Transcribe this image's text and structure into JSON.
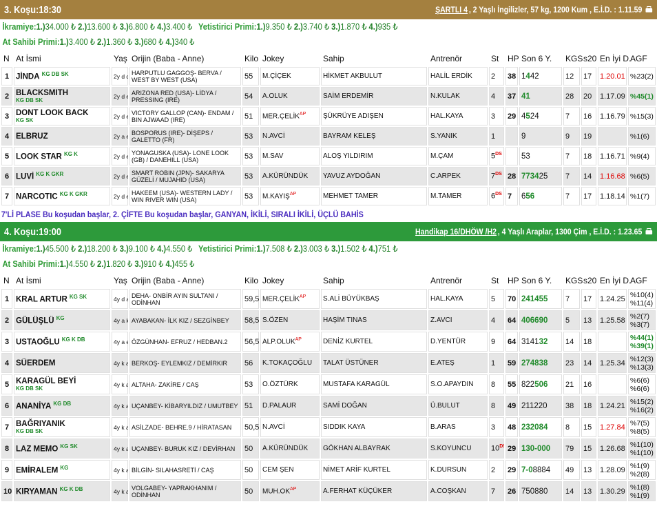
{
  "race3": {
    "title": "3. Koşu:18:30",
    "cond": "ŞARTLI 4",
    "info": " , 2 Yaşlı İngilizler, 57 kg, 1200 Kum , E.İ.D. : 1.11.59",
    "prize_line1": [
      {
        "label": "İkramiye:",
        "items": [
          {
            "k": "1.)",
            "v": "34.000 ₺"
          },
          {
            "k": "2.)",
            "v": "13.600 ₺"
          },
          {
            "k": "3.)",
            "v": "6.800 ₺"
          },
          {
            "k": "4.)",
            "v": "3.400 ₺"
          }
        ]
      },
      {
        "label": "Yetistirici Primi:",
        "items": [
          {
            "k": "1.)",
            "v": "9.350 ₺"
          },
          {
            "k": "2.)",
            "v": "3.740 ₺"
          },
          {
            "k": "3.)",
            "v": "1.870 ₺"
          },
          {
            "k": "4.)",
            "v": "935 ₺"
          }
        ]
      }
    ],
    "prize_line2": [
      {
        "label": "At Sahibi Primi:",
        "items": [
          {
            "k": "1.)",
            "v": "3.400 ₺"
          },
          {
            "k": "2.)",
            "v": "1.360 ₺"
          },
          {
            "k": "3.)",
            "v": "680 ₺"
          },
          {
            "k": "4.)",
            "v": "340 ₺"
          }
        ]
      }
    ],
    "headers": [
      "N",
      "At İsmi",
      "Yaş",
      "Orijin (Baba - Anne)",
      "Kilo",
      "Jokey",
      "Sahip",
      "Antrenör",
      "St",
      "HP",
      "Son 6 Y.",
      "KGS",
      "s20",
      "En İyi D.",
      "AGF"
    ],
    "rows": [
      {
        "n": "1",
        "name": "JİNDA",
        "tag": "KG DB SK",
        "tag_block": false,
        "age": "2y d d",
        "orig": "HARPUTLU GAGGOŞ- BERVA / WEST BY WEST (USA)",
        "kilo": "55",
        "jockey": "M.ÇİÇEK",
        "ap": "",
        "owner": "HİKMET AKBULUT",
        "trainer": "HALİL ERDİK",
        "st": "2",
        "ds": "",
        "hp": "38",
        "son": [
          {
            "t": "1",
            "g": false
          },
          {
            "t": "4",
            "g": true
          },
          {
            "t": "42",
            "g": false
          }
        ],
        "kgs": "12",
        "s20": "17",
        "best": "1.20.01",
        "best_red": true,
        "agf": [
          {
            "t": "%23(2)",
            "g": false
          }
        ]
      },
      {
        "n": "2",
        "name": "BLACKSMITH",
        "tag": "KG DB SK",
        "tag_block": true,
        "age": "2y d e",
        "orig": "ARIZONA RED (USA)- LİDYA / PRESSING (IRE)",
        "kilo": "54",
        "jockey": "A.OLUK",
        "ap": "",
        "owner": "SAİM ERDEMİR",
        "trainer": "N.KULAK",
        "st": "4",
        "ds": "",
        "hp": "37",
        "son": [
          {
            "t": "41",
            "g": true
          }
        ],
        "kgs": "28",
        "s20": "20",
        "best": "1.17.09",
        "best_red": false,
        "agf": [
          {
            "t": "%45(1)",
            "g": true
          }
        ]
      },
      {
        "n": "3",
        "name": "DONT LOOK BACK",
        "tag": "KG SK",
        "tag_block": true,
        "age": "2y d e",
        "orig": "VICTORY GALLOP (CAN)- ENDAM / BIN AJWAAD (IRE)",
        "kilo": "51",
        "jockey": "MER.ÇELİK",
        "ap": "AP",
        "owner": "ŞÜKRÜYE ADIŞEN",
        "trainer": "HAL.KAYA",
        "st": "3",
        "ds": "",
        "hp": "29",
        "son": [
          {
            "t": "4",
            "g": false
          },
          {
            "t": "5",
            "g": true
          },
          {
            "t": "24",
            "g": false
          }
        ],
        "kgs": "7",
        "s20": "16",
        "best": "1.16.79",
        "best_red": false,
        "agf": [
          {
            "t": "%15(3)",
            "g": false
          }
        ]
      },
      {
        "n": "4",
        "name": "ELBRUZ",
        "tag": "",
        "tag_block": false,
        "age": "2y a e",
        "orig": "BOSPORUS (IRE)- DİŞEPS / GALETTO (FR)",
        "kilo": "53",
        "jockey": "N.AVCİ",
        "ap": "",
        "owner": "BAYRAM KELEŞ",
        "trainer": "S.YANIK",
        "st": "1",
        "ds": "",
        "hp": "",
        "son": [
          {
            "t": "9",
            "g": false
          }
        ],
        "kgs": "9",
        "s20": "19",
        "best": "",
        "best_red": false,
        "agf": [
          {
            "t": "%1(6)",
            "g": false
          }
        ]
      },
      {
        "n": "5",
        "name": "LOOK STAR",
        "tag": "KG K",
        "tag_block": false,
        "age": "2y d e",
        "orig": "YONAGUSKA (USA)- LONE LOOK (GB) / DANEHILL (USA)",
        "kilo": "53",
        "jockey": "M.SAV",
        "ap": "",
        "owner": "ALOŞ YILDIRIM",
        "trainer": "M.ÇAM",
        "st": "5",
        "ds": "DS",
        "hp": "",
        "son": [
          {
            "t": "53",
            "g": false
          }
        ],
        "kgs": "7",
        "s20": "18",
        "best": "1.16.71",
        "best_red": false,
        "agf": [
          {
            "t": "%9(4)",
            "g": false
          }
        ]
      },
      {
        "n": "6",
        "name": "LUVİ",
        "tag": "KG K GKR",
        "tag_block": false,
        "age": "2y d e",
        "orig": "SMART ROBIN (JPN)- SAKARYA GÜZELİ / MUJAHID (USA)",
        "kilo": "53",
        "jockey": "A.KÜRÜNDÜK",
        "ap": "",
        "owner": "YAVUZ AYDOĞAN",
        "trainer": "C.ARPEK",
        "st": "7",
        "ds": "DS",
        "hp": "28",
        "son": [
          {
            "t": "7734",
            "g": true
          },
          {
            "t": "25",
            "g": false
          }
        ],
        "kgs": "7",
        "s20": "14",
        "best": "1.16.68",
        "best_red": true,
        "agf": [
          {
            "t": "%6(5)",
            "g": false
          }
        ]
      },
      {
        "n": "7",
        "name": "NARCOTIC",
        "tag": "KG K GKR",
        "tag_block": false,
        "age": "2y d e",
        "orig": "HAKEEM (USA)- WESTERN LADY / WIN RIVER WIN (USA)",
        "kilo": "53",
        "jockey": "M.KAYIŞ",
        "ap": "AP",
        "owner": "MEHMET TAMER",
        "trainer": "M.TAMER",
        "st": "6",
        "ds": "DS",
        "hp": "7",
        "son": [
          {
            "t": "6",
            "g": false
          },
          {
            "t": "56",
            "g": true
          }
        ],
        "kgs": "7",
        "s20": "17",
        "best": "1.18.14",
        "best_red": false,
        "agf": [
          {
            "t": "%1(7)",
            "g": false
          }
        ]
      }
    ]
  },
  "bets_line": "7'Lİ PLASE Bu koşudan başlar, 2. ÇİFTE Bu koşudan başlar, GANYAN, İKİLİ, SIRALI İKİLİ, ÜÇLÜ BAHİS",
  "race4": {
    "title": "4. Koşu:19:00",
    "cond": "Handikap 16/DHÖW /H2",
    "info": " , 4 Yaşlı Araplar, 1300 Çim , E.İ.D. : 1.23.65",
    "prize_line1": [
      {
        "label": "İkramiye:",
        "items": [
          {
            "k": "1.)",
            "v": "45.500 ₺"
          },
          {
            "k": "2.)",
            "v": "18.200 ₺"
          },
          {
            "k": "3.)",
            "v": "9.100 ₺"
          },
          {
            "k": "4.)",
            "v": "4.550 ₺"
          }
        ]
      },
      {
        "label": "Yetistirici Primi:",
        "items": [
          {
            "k": "1.)",
            "v": "7.508 ₺"
          },
          {
            "k": "2.)",
            "v": "3.003 ₺"
          },
          {
            "k": "3.)",
            "v": "1.502 ₺"
          },
          {
            "k": "4.)",
            "v": "751 ₺"
          }
        ]
      }
    ],
    "prize_line2": [
      {
        "label": "At Sahibi Primi:",
        "items": [
          {
            "k": "1.)",
            "v": "4.550 ₺"
          },
          {
            "k": "2.)",
            "v": "1.820 ₺"
          },
          {
            "k": "3.)",
            "v": "910 ₺"
          },
          {
            "k": "4.)",
            "v": "455 ₺"
          }
        ]
      }
    ],
    "headers": [
      "N",
      "At İsmi",
      "Yaş",
      "Orijin (Baba - Anne)",
      "Kilo",
      "Jokey",
      "Sahip",
      "Antrenör",
      "St",
      "HP",
      "Son 6 Y.",
      "KGS",
      "s20",
      "En İyi D.",
      "AGF"
    ],
    "rows": [
      {
        "n": "1",
        "name": "KRAL ARTUR",
        "tag": "KG SK",
        "tag_block": false,
        "age": "4y d a",
        "orig": "DEHA- ONBİR AYIN SULTANI / ODİNHAN",
        "kilo": "59,5",
        "jockey": "MER.ÇELİK",
        "ap": "AP",
        "owner": "S.ALİ BÜYÜKBAŞ",
        "trainer": "HAL.KAYA",
        "st": "5",
        "ds": "",
        "hp": "70",
        "son": [
          {
            "t": "241455",
            "g": true
          }
        ],
        "kgs": "7",
        "s20": "17",
        "best": "1.24.25",
        "best_red": false,
        "agf": [
          {
            "t": "%10(4)",
            "g": false
          },
          {
            "t": "%11(4)",
            "g": false
          }
        ]
      },
      {
        "n": "2",
        "name": "GÜLÜŞLÜ",
        "tag": "KG",
        "tag_block": false,
        "age": "4y a k",
        "orig": "AYABAKAN- İLK KIZ / SEZGİNBEY",
        "kilo": "58,5",
        "jockey": "S.ÖZEN",
        "ap": "",
        "owner": "HAŞİM TINAS",
        "trainer": "Z.AVCI",
        "st": "4",
        "ds": "",
        "hp": "64",
        "son": [
          {
            "t": "406690",
            "g": true
          }
        ],
        "kgs": "5",
        "s20": "13",
        "best": "1.25.58",
        "best_red": false,
        "agf": [
          {
            "t": "%2(7)",
            "g": false
          },
          {
            "t": "%3(7)",
            "g": false
          }
        ]
      },
      {
        "n": "3",
        "name": "USTAOĞLU",
        "tag": "KG K DB",
        "tag_block": false,
        "age": "4y a e",
        "orig": "ÖZGÜNHAN- EFRUZ / HEDBAN.2",
        "kilo": "56,5",
        "jockey": "ALP.OLUK",
        "ap": "AP",
        "owner": "DENİZ KURTEL",
        "trainer": "D.YENTÜR",
        "st": "9",
        "ds": "",
        "hp": "64",
        "son": [
          {
            "t": "3141",
            "g": false
          },
          {
            "t": "32",
            "g": true
          }
        ],
        "kgs": "14",
        "s20": "18",
        "best": "",
        "best_red": false,
        "agf": [
          {
            "t": "%44(1)",
            "g": true
          },
          {
            "t": "%39(1)",
            "g": true
          }
        ]
      },
      {
        "n": "4",
        "name": "SÜERDEM",
        "tag": "",
        "tag_block": false,
        "age": "4y k a",
        "orig": "BERKOŞ- EYLEMKIZ / DEMİRKIR",
        "kilo": "56",
        "jockey": "K.TOKAÇOĞLU",
        "ap": "",
        "owner": "TALAT ÜSTÜNER",
        "trainer": "E.ATEŞ",
        "st": "1",
        "ds": "",
        "hp": "59",
        "son": [
          {
            "t": "274838",
            "g": true
          }
        ],
        "kgs": "23",
        "s20": "14",
        "best": "1.25.34",
        "best_red": false,
        "agf": [
          {
            "t": "%12(3)",
            "g": false
          },
          {
            "t": "%13(3)",
            "g": false
          }
        ]
      },
      {
        "n": "5",
        "name": "KARAGÜL BEYİ",
        "tag": "KG DB SK",
        "tag_block": true,
        "age": "4y k a",
        "orig": "ALTAHA- ZAKİRE / CAŞ",
        "kilo": "53",
        "jockey": "O.ÖZTÜRK",
        "ap": "",
        "owner": "MUSTAFA KARAGÜL",
        "trainer": "S.O.APAYDIN",
        "st": "8",
        "ds": "",
        "hp": "55",
        "son": [
          {
            "t": "822",
            "g": false
          },
          {
            "t": "506",
            "g": true
          }
        ],
        "kgs": "21",
        "s20": "16",
        "best": "",
        "best_red": false,
        "agf": [
          {
            "t": "%6(6)",
            "g": false
          },
          {
            "t": "%6(6)",
            "g": false
          }
        ]
      },
      {
        "n": "6",
        "name": "ANANİYA",
        "tag": "KG DB",
        "tag_block": false,
        "age": "4y k a",
        "orig": "UÇANBEY- KİBARYILDIZ / UMUTBEY",
        "kilo": "51",
        "jockey": "D.PALAUR",
        "ap": "",
        "owner": "SAMİ DOĞAN",
        "trainer": "Ü.BULUT",
        "st": "8",
        "ds": "",
        "hp": "49",
        "son": [
          {
            "t": "211220",
            "g": false
          }
        ],
        "kgs": "38",
        "s20": "18",
        "best": "1.24.21",
        "best_red": false,
        "agf": [
          {
            "t": "%15(2)",
            "g": false
          },
          {
            "t": "%16(2)",
            "g": false
          }
        ]
      },
      {
        "n": "7",
        "name": "BAĞRIYANIK",
        "tag": "KG DB SK",
        "tag_block": true,
        "age": "4y k a",
        "orig": "ASİLZADE- BEHRE.9 / HİRATASAN",
        "kilo": "50,5",
        "jockey": "N.AVCİ",
        "ap": "",
        "owner": "SIDDIK KAYA",
        "trainer": "B.ARAS",
        "st": "3",
        "ds": "",
        "hp": "48",
        "son": [
          {
            "t": "232084",
            "g": true
          }
        ],
        "kgs": "8",
        "s20": "15",
        "best": "1.27.84",
        "best_red": true,
        "agf": [
          {
            "t": "%7(5)",
            "g": false
          },
          {
            "t": "%8(5)",
            "g": false
          }
        ]
      },
      {
        "n": "8",
        "name": "LAZ MEMO",
        "tag": "KG SK",
        "tag_block": false,
        "age": "4y k a",
        "orig": "UÇANBEY- BURUK KIZ / DEVİRHAN",
        "kilo": "50",
        "jockey": "A.KÜRÜNDÜK",
        "ap": "",
        "owner": "GÖKHAN ALBAYRAK",
        "trainer": "S.KOYUNCU",
        "st": "10",
        "ds": "DS",
        "hp": "29",
        "son": [
          {
            "t": "130-000",
            "g": true
          }
        ],
        "kgs": "79",
        "s20": "15",
        "best": "1.26.68",
        "best_red": false,
        "agf": [
          {
            "t": "%1(10)",
            "g": false
          },
          {
            "t": "%1(10)",
            "g": false
          }
        ]
      },
      {
        "n": "9",
        "name": "EMİRALEM",
        "tag": "KG",
        "tag_block": false,
        "age": "4y k a",
        "orig": "BİLGİN- SILAHASRETİ / CAŞ",
        "kilo": "50",
        "jockey": "CEM ŞEN",
        "ap": "",
        "owner": "NİMET ARİF KURTEL",
        "trainer": "K.DURSUN",
        "st": "2",
        "ds": "",
        "hp": "29",
        "son": [
          {
            "t": "7-0",
            "g": true
          },
          {
            "t": "8884",
            "g": false
          }
        ],
        "kgs": "49",
        "s20": "13",
        "best": "1.28.09",
        "best_red": false,
        "agf": [
          {
            "t": "%1(9)",
            "g": false
          },
          {
            "t": "%2(8)",
            "g": false
          }
        ]
      },
      {
        "n": "10",
        "name": "KIRYAMAN",
        "tag": "KG K DB",
        "tag_block": false,
        "age": "4y k a",
        "orig": "VOLGABEY- YAPRAKHANIM / ODİNHAN",
        "kilo": "50",
        "jockey": "MUH.OK",
        "ap": "AP",
        "owner": "A.FERHAT KÜÇÜKER",
        "trainer": "A.COŞKAN",
        "st": "7",
        "ds": "",
        "hp": "26",
        "son": [
          {
            "t": "750880",
            "g": false
          }
        ],
        "kgs": "14",
        "s20": "13",
        "best": "1.30.29",
        "best_red": false,
        "agf": [
          {
            "t": "%1(8)",
            "g": false
          },
          {
            "t": "%1(9)",
            "g": false
          }
        ]
      }
    ]
  }
}
